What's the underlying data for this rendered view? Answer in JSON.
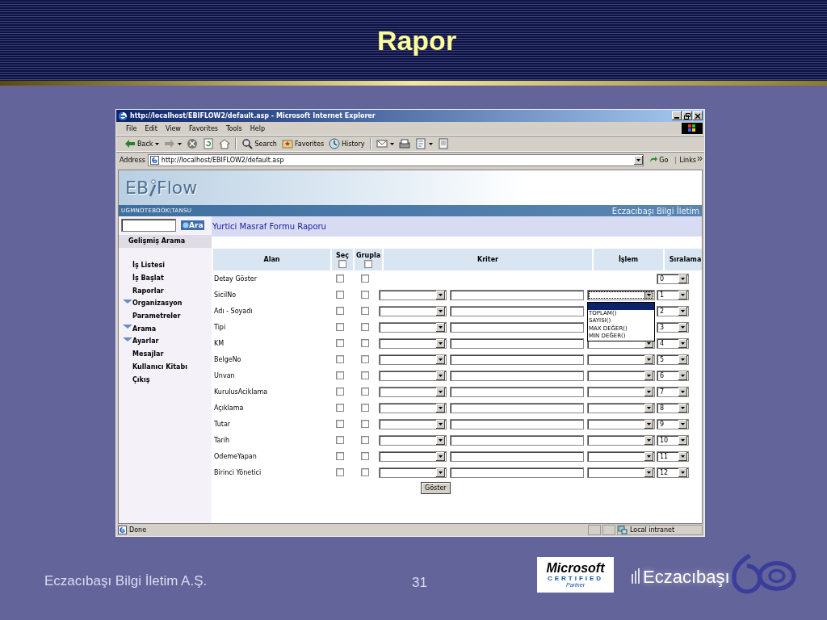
{
  "slide": {
    "title": "Rapor",
    "footer_text": "Eczacıbaşı Bilgi İletim A.Ş.",
    "page_number": "31",
    "partner_logo": {
      "brand": "Microsoft",
      "line": "CERTIFIED",
      "sub": "Partner"
    },
    "company_logo": "Eczacıbaşı"
  },
  "browser": {
    "title": "http://localhost/EBIFLOW2/default.asp - Microsoft Internet Explorer",
    "menu": [
      "File",
      "Edit",
      "View",
      "Favorites",
      "Tools",
      "Help"
    ],
    "toolbar": [
      {
        "kind": "back",
        "label": "Back",
        "dropdown": true
      },
      {
        "kind": "forward",
        "dropdown": true
      },
      {
        "kind": "stop",
        "dropdown": false
      },
      {
        "kind": "refresh",
        "dropdown": false
      },
      {
        "kind": "home",
        "dropdown": false
      },
      {
        "kind": "search",
        "label": "Search",
        "dropdown": false
      },
      {
        "kind": "favorites",
        "label": "Favorites",
        "dropdown": false
      },
      {
        "kind": "history",
        "label": "History",
        "dropdown": false
      },
      {
        "kind": "mail",
        "dropdown": true
      },
      {
        "kind": "print",
        "dropdown": false
      },
      {
        "kind": "edit",
        "dropdown": true
      },
      {
        "kind": "discuss",
        "dropdown": false
      }
    ],
    "address_label": "Address",
    "url": "http://localhost/EBIFLOW2/default.asp",
    "go": "Go",
    "links": "Links",
    "status": "Done",
    "zone": "Local intranet"
  },
  "app": {
    "logo_left": "EB",
    "logo_right": "Flow",
    "user": "UGMNOTEBOOK\\TANSU",
    "brand": "Eczacıbaşı Bilgi İletim",
    "search_button": "Ara",
    "advanced_search": "Gelişmiş Arama",
    "nav": [
      {
        "label": "İş Listesi",
        "expandable": false
      },
      {
        "label": "İş Başlat",
        "expandable": false
      },
      {
        "label": "Raporlar",
        "expandable": false
      },
      {
        "label": "Organizasyon",
        "expandable": true
      },
      {
        "label": "Parametreler",
        "expandable": false
      },
      {
        "label": "Arama",
        "expandable": true
      },
      {
        "label": "Ayarlar",
        "expandable": true
      },
      {
        "label": "Mesajlar",
        "expandable": false
      },
      {
        "label": "Kullanıcı Kitabı",
        "expandable": false
      },
      {
        "label": "Çıkış",
        "expandable": false
      }
    ],
    "report_title": "Yurtici Masraf Formu Raporu",
    "columns": [
      "Alan",
      "Seç",
      "Grupla",
      "Kriter",
      "İşlem",
      "Sıralama"
    ],
    "header_checks": {
      "select_all": false,
      "group_all": false
    },
    "rows": [
      {
        "kind": "option",
        "field": "Detay Göster",
        "checked": false,
        "grouped": false,
        "order": "0"
      },
      {
        "kind": "field",
        "field": "SicilNo",
        "checked": false,
        "grouped": false,
        "order": "1",
        "menu_open": true
      },
      {
        "kind": "field",
        "field": "Adı - Soyadı",
        "checked": false,
        "grouped": false,
        "order": "2",
        "menu_open": false
      },
      {
        "kind": "field",
        "field": "Tipi",
        "checked": false,
        "grouped": false,
        "order": "3",
        "menu_open": false
      },
      {
        "kind": "field",
        "field": "KM",
        "checked": false,
        "grouped": false,
        "order": "4",
        "menu_open": false
      },
      {
        "kind": "field",
        "field": "BelgeNo",
        "checked": false,
        "grouped": false,
        "order": "5",
        "menu_open": false
      },
      {
        "kind": "field",
        "field": "Unvan",
        "checked": false,
        "grouped": false,
        "order": "6",
        "menu_open": false
      },
      {
        "kind": "field",
        "field": "KurulusAciklama",
        "checked": false,
        "grouped": false,
        "order": "7",
        "menu_open": false
      },
      {
        "kind": "field",
        "field": "Açıklama",
        "checked": false,
        "grouped": false,
        "order": "8",
        "menu_open": false
      },
      {
        "kind": "field",
        "field": "Tutar",
        "checked": false,
        "grouped": false,
        "order": "9",
        "menu_open": false
      },
      {
        "kind": "field",
        "field": "Tarih",
        "checked": false,
        "grouped": false,
        "order": "10",
        "menu_open": false
      },
      {
        "kind": "field",
        "field": "OdemeYapan",
        "checked": false,
        "grouped": false,
        "order": "11",
        "menu_open": false
      },
      {
        "kind": "field",
        "field": "Birinci Yönetici",
        "checked": false,
        "grouped": false,
        "order": "12",
        "menu_open": false
      }
    ],
    "operation_options": [
      "TOPLAM()",
      "SAYISI()",
      "MAX DEĞER()",
      "MIN DEĞER()"
    ],
    "submit": "Göster"
  }
}
